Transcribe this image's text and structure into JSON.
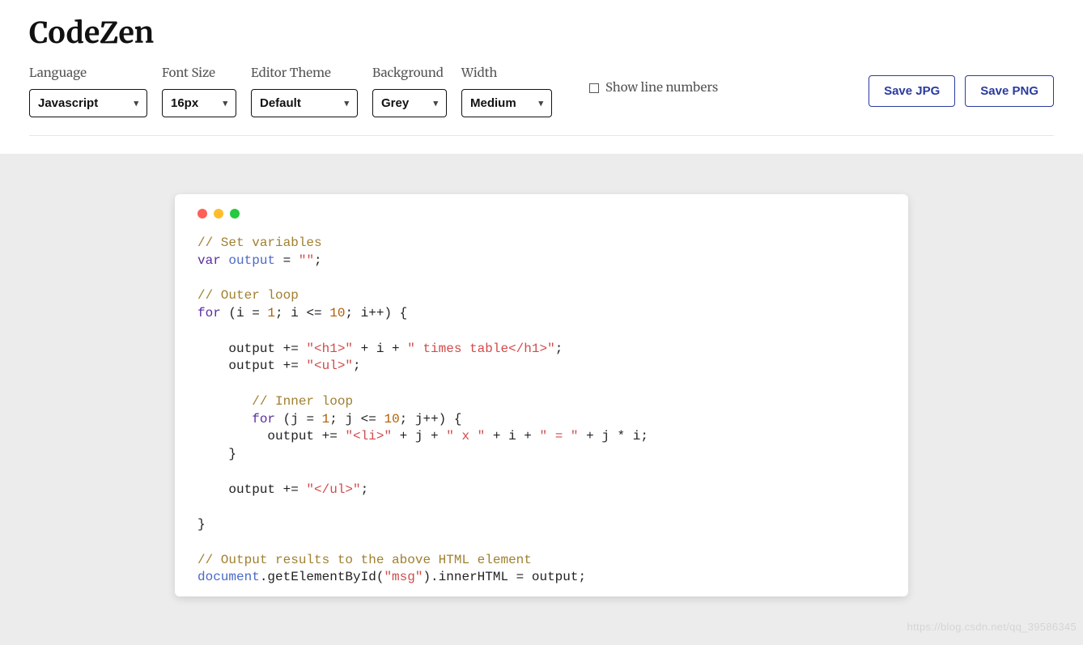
{
  "app": {
    "title": "CodeZen"
  },
  "toolbar": {
    "language": {
      "label": "Language",
      "value": "Javascript"
    },
    "fontsize": {
      "label": "Font Size",
      "value": "16px"
    },
    "theme": {
      "label": "Editor Theme",
      "value": "Default"
    },
    "background": {
      "label": "Background",
      "value": "Grey"
    },
    "width": {
      "label": "Width",
      "value": "Medium"
    },
    "linenumbers": {
      "label": "Show line numbers",
      "checked": false
    },
    "save_jpg": "Save JPG",
    "save_png": "Save PNG"
  },
  "editor": {
    "colors": {
      "bg_stage": "#ececec",
      "frame_bg": "#ffffff",
      "dot_red": "#ff5f56",
      "dot_yellow": "#ffbd2e",
      "dot_green": "#27c93f",
      "comment": "#a08030",
      "keyword": "#5a2ca0",
      "variable": "#4b69c6",
      "string": "#d14b4b",
      "number": "#b35c00"
    },
    "code_tokens": [
      [
        [
          "comment",
          "// Set variables"
        ]
      ],
      [
        [
          "kw",
          "var"
        ],
        [
          "plain",
          " "
        ],
        [
          "var",
          "output"
        ],
        [
          "plain",
          " = "
        ],
        [
          "str",
          "\"\""
        ],
        [
          "plain",
          ";"
        ]
      ],
      [],
      [
        [
          "comment",
          "// Outer loop"
        ]
      ],
      [
        [
          "kw",
          "for"
        ],
        [
          "plain",
          " (i = "
        ],
        [
          "num",
          "1"
        ],
        [
          "plain",
          "; i <= "
        ],
        [
          "num",
          "10"
        ],
        [
          "plain",
          "; i++) {"
        ]
      ],
      [],
      [
        [
          "plain",
          "    output += "
        ],
        [
          "str",
          "\"<h1>\""
        ],
        [
          "plain",
          " + i + "
        ],
        [
          "str",
          "\" times table</h1>\""
        ],
        [
          "plain",
          ";"
        ]
      ],
      [
        [
          "plain",
          "    output += "
        ],
        [
          "str",
          "\"<ul>\""
        ],
        [
          "plain",
          ";"
        ]
      ],
      [],
      [
        [
          "plain",
          "       "
        ],
        [
          "comment",
          "// Inner loop"
        ]
      ],
      [
        [
          "plain",
          "       "
        ],
        [
          "kw",
          "for"
        ],
        [
          "plain",
          " (j = "
        ],
        [
          "num",
          "1"
        ],
        [
          "plain",
          "; j <= "
        ],
        [
          "num",
          "10"
        ],
        [
          "plain",
          "; j++) {"
        ]
      ],
      [
        [
          "plain",
          "         output += "
        ],
        [
          "str",
          "\"<li>\""
        ],
        [
          "plain",
          " + j + "
        ],
        [
          "str",
          "\" x \""
        ],
        [
          "plain",
          " + i + "
        ],
        [
          "str",
          "\" = \""
        ],
        [
          "plain",
          " + j * i;"
        ]
      ],
      [
        [
          "plain",
          "    }"
        ]
      ],
      [],
      [
        [
          "plain",
          "    output += "
        ],
        [
          "str",
          "\"</ul>\""
        ],
        [
          "plain",
          ";"
        ]
      ],
      [],
      [
        [
          "plain",
          "}"
        ]
      ],
      [],
      [
        [
          "comment",
          "// Output results to the above HTML element"
        ]
      ],
      [
        [
          "var",
          "document"
        ],
        [
          "plain",
          ".getElementById("
        ],
        [
          "str",
          "\"msg\""
        ],
        [
          "plain",
          ").innerHTML = output;"
        ]
      ]
    ]
  },
  "watermark": "https://blog.csdn.net/qq_39586345"
}
